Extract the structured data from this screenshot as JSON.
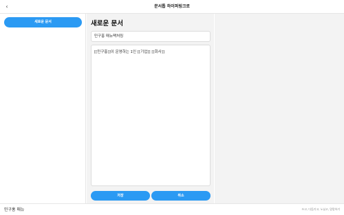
{
  "header": {
    "back_glyph": "‹",
    "title": "문서톱 하이퍼링크로"
  },
  "sidebar": {
    "new_doc_label": "새로운 문서"
  },
  "editor": {
    "heading": "새로운 문서",
    "name_value": "민구홍 매뉴팩처링",
    "content_value": "[[민구홍]]이 운영하는 1인 [[기업]] [[회사]]",
    "save_label": "저장",
    "cancel_label": "취소"
  },
  "footer": {
    "logo": "민구홍 매뉴",
    "links": "쓰고, 다듬기고, 노닐고, 망망하기"
  },
  "colors": {
    "accent": "#2b9af3",
    "panel_bg": "#f3f3f3"
  }
}
